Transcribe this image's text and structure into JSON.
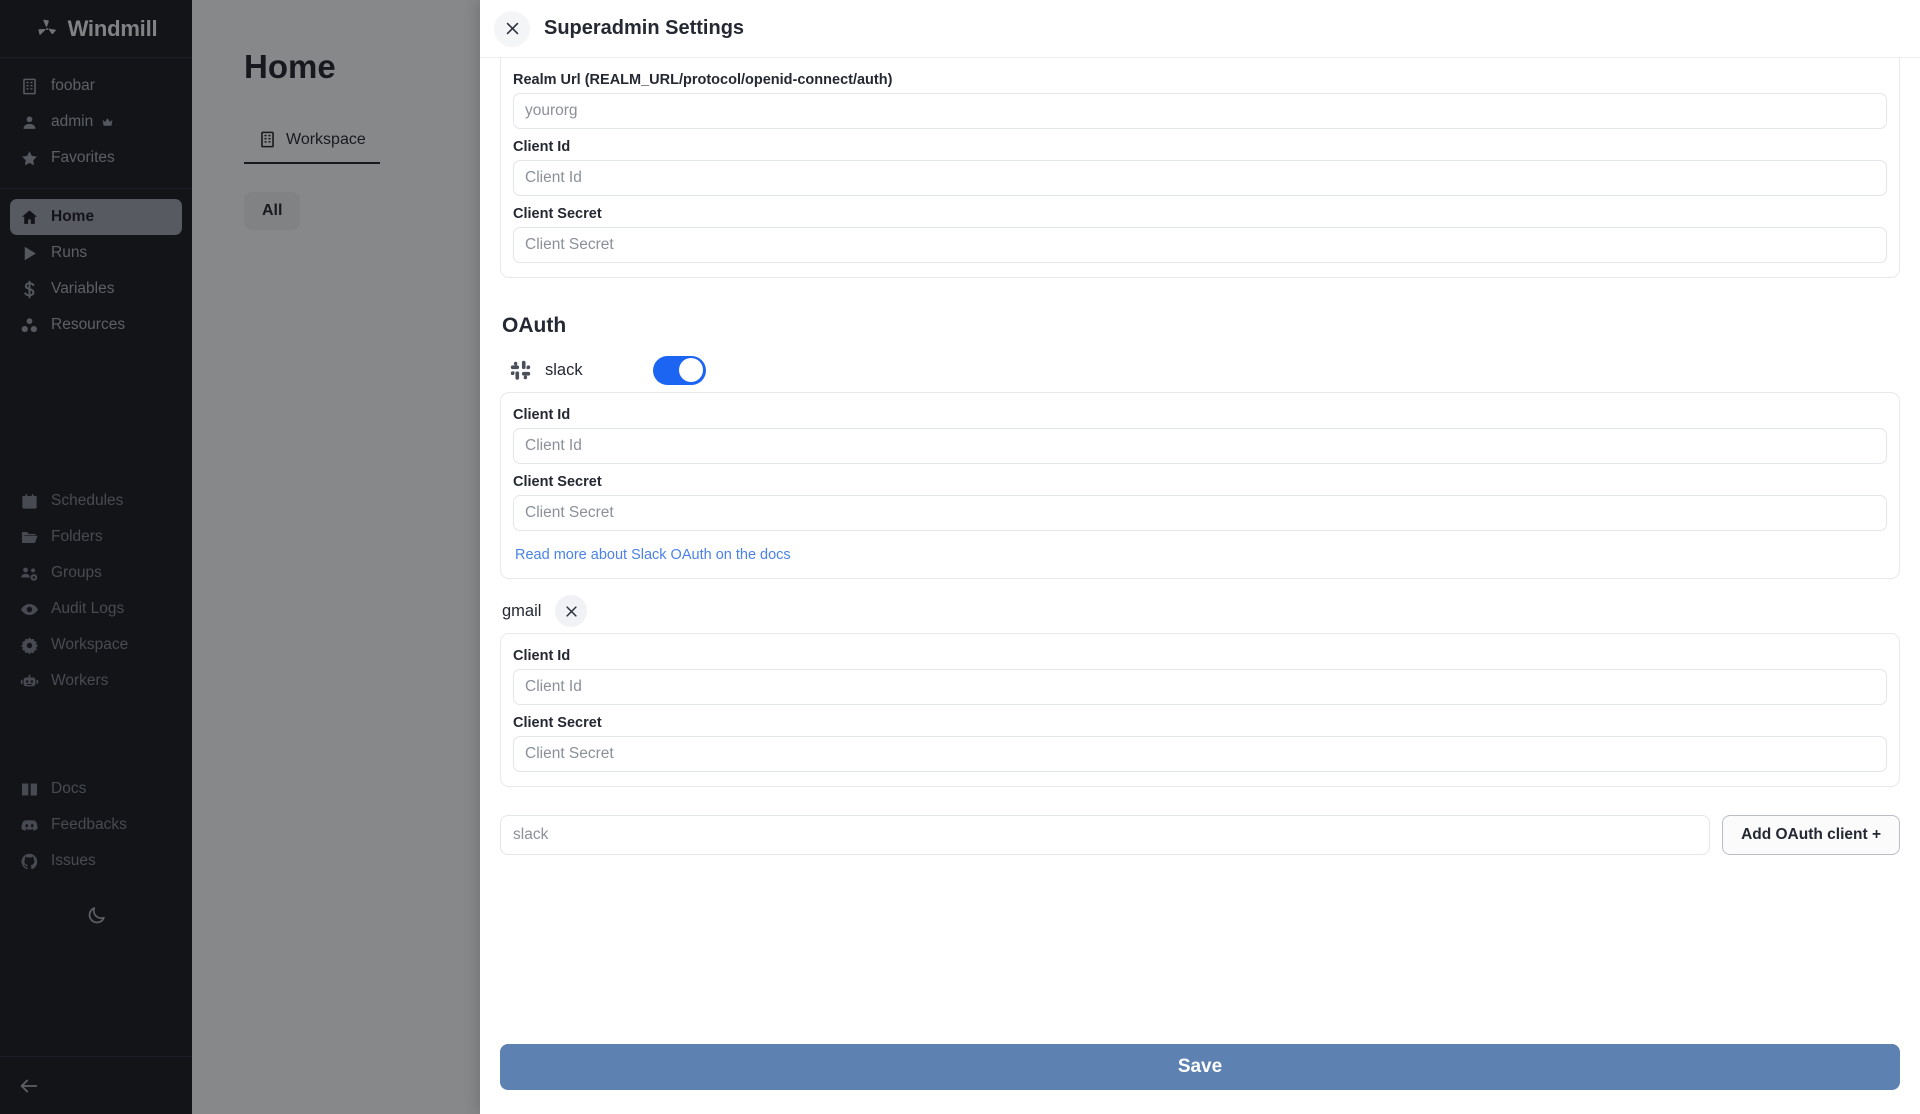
{
  "sidebar": {
    "brand": "Windmill",
    "brand_icon": "windmill-logo",
    "context": [
      {
        "label": "foobar",
        "icon": "building-icon"
      },
      {
        "label": "admin",
        "icon": "user-icon",
        "badge_icon": "crown-icon"
      },
      {
        "label": "Favorites",
        "icon": "star-icon"
      }
    ],
    "primary": [
      {
        "label": "Home",
        "icon": "home-icon",
        "active": true
      },
      {
        "label": "Runs",
        "icon": "play-icon",
        "active": false
      },
      {
        "label": "Variables",
        "icon": "dollar-icon",
        "active": false
      },
      {
        "label": "Resources",
        "icon": "resources-icon",
        "active": false
      }
    ],
    "admin": [
      {
        "label": "Schedules",
        "icon": "calendar-icon"
      },
      {
        "label": "Folders",
        "icon": "folder-icon"
      },
      {
        "label": "Groups",
        "icon": "groups-icon"
      },
      {
        "label": "Audit Logs",
        "icon": "eye-icon"
      },
      {
        "label": "Workspace",
        "icon": "gear-icon"
      },
      {
        "label": "Workers",
        "icon": "robot-icon"
      }
    ],
    "help": [
      {
        "label": "Docs",
        "icon": "book-icon"
      },
      {
        "label": "Feedbacks",
        "icon": "discord-icon"
      },
      {
        "label": "Issues",
        "icon": "github-icon"
      }
    ],
    "theme_toggle_icon": "moon-icon",
    "collapse_icon": "arrow-left-icon"
  },
  "page": {
    "title": "Home",
    "tab_label": "Workspace",
    "tab_icon": "building-icon",
    "filter_chip": "All"
  },
  "modal": {
    "title": "Superadmin Settings",
    "close_icon": "close-icon",
    "sso": {
      "realm_url": {
        "label": "Realm Url (REALM_URL/protocol/openid-connect/auth)",
        "placeholder": "yourorg",
        "value": ""
      },
      "client_id": {
        "label": "Client Id",
        "placeholder": "Client Id",
        "value": ""
      },
      "client_secret": {
        "label": "Client Secret",
        "placeholder": "Client Secret",
        "value": ""
      }
    },
    "oauth": {
      "section_title": "OAuth",
      "providers": [
        {
          "name": "slack",
          "icon": "slack-icon",
          "has_toggle": true,
          "enabled": true,
          "has_remove": false,
          "client_id": {
            "label": "Client Id",
            "placeholder": "Client Id",
            "value": ""
          },
          "client_secret": {
            "label": "Client Secret",
            "placeholder": "Client Secret",
            "value": ""
          },
          "docs_link": "Read more about Slack OAuth on the docs"
        },
        {
          "name": "gmail",
          "icon": null,
          "has_toggle": false,
          "enabled": false,
          "has_remove": true,
          "remove_icon": "close-icon",
          "client_id": {
            "label": "Client Id",
            "placeholder": "Client Id",
            "value": ""
          },
          "client_secret": {
            "label": "Client Secret",
            "placeholder": "Client Secret",
            "value": ""
          },
          "docs_link": null
        }
      ],
      "add_input_placeholder": "slack",
      "add_input_value": "",
      "add_button_label": "Add OAuth client +"
    },
    "save_label": "Save"
  },
  "colors": {
    "accent_blue": "#1c64f2",
    "save_blue": "#5d82b2",
    "link_blue": "#4b82e8",
    "sidebar_bg": "#14161d"
  }
}
